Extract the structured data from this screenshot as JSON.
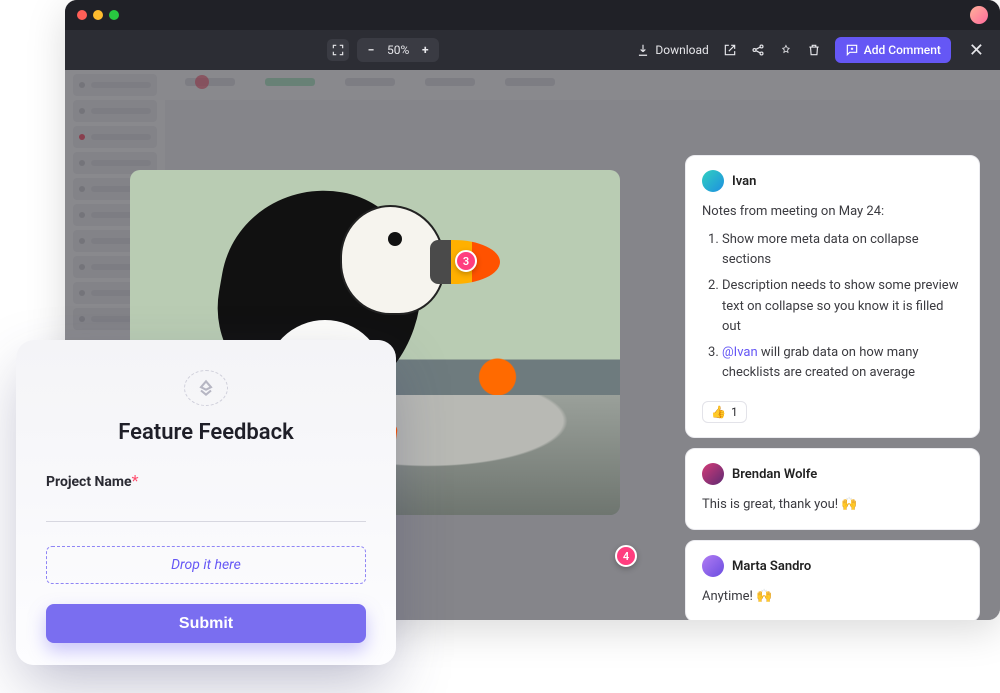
{
  "toolbar": {
    "zoom_minus": "−",
    "zoom_plus": "+",
    "zoom_level": "50%",
    "download_label": "Download",
    "add_comment_label": "Add Comment"
  },
  "image": {
    "pins": {
      "pin3": "3",
      "pin4": "4"
    }
  },
  "comments": [
    {
      "author": "Ivan",
      "intro": "Notes from meeting on May 24:",
      "items": [
        "Show more meta data on collapse sections",
        "Description needs to show some preview text on collapse so you know it is filled out"
      ],
      "item3_mention": "@Ivan",
      "item3_rest": " will grab data on how many checklists are created on average",
      "reaction_emoji": "👍",
      "reaction_count": "1"
    },
    {
      "author": "Brendan Wolfe",
      "body": "This is great, thank you! 🙌"
    },
    {
      "author": "Marta Sandro",
      "body": "Anytime! 🙌"
    }
  ],
  "form": {
    "title": "Feature Feedback",
    "field_label": "Project Name",
    "required_mark": "*",
    "dropzone_text": "Drop it here",
    "submit_label": "Submit"
  }
}
